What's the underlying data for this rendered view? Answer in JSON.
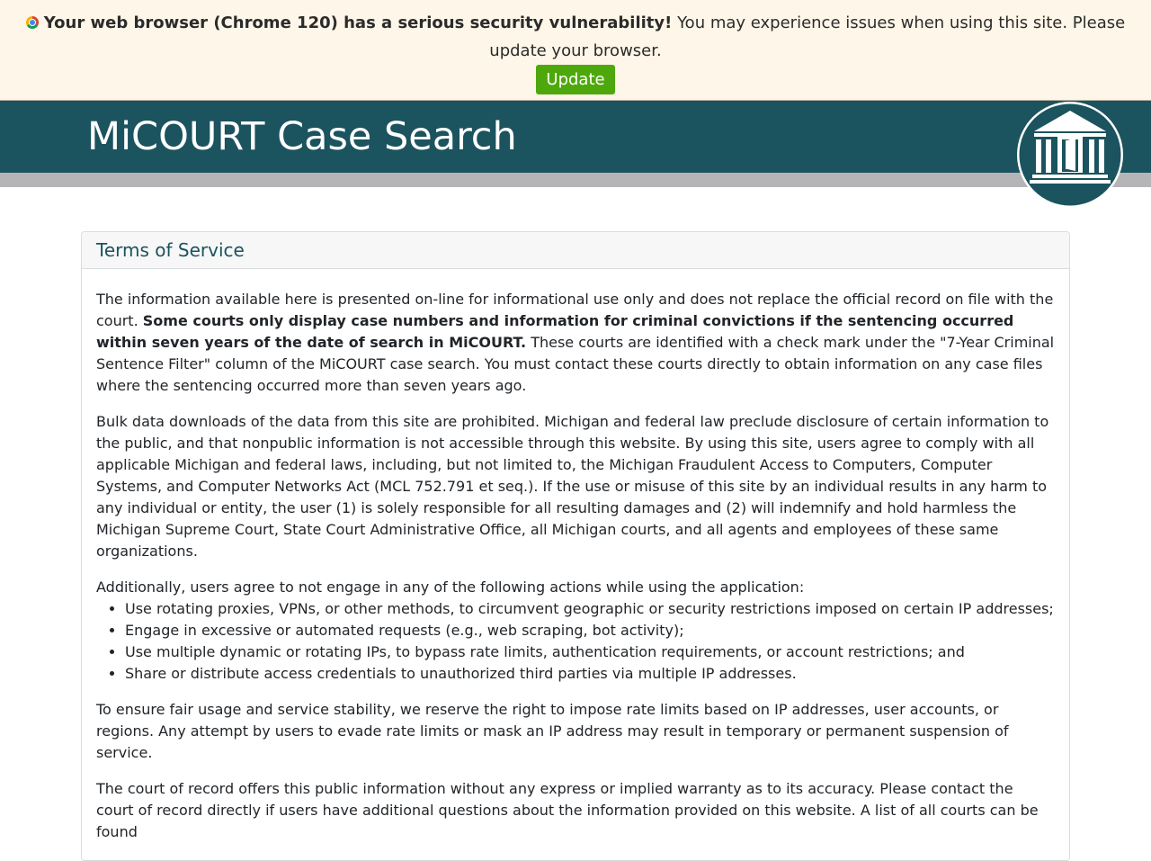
{
  "banner": {
    "warning_bold": "Your web browser (Chrome 120) has a serious security vulnerability!",
    "warning_rest": " You may experience issues when using this site. Please update your browser.",
    "update_label": "Update",
    "colors": {
      "background": "#fef6e8",
      "button": "#4ea80b"
    }
  },
  "header": {
    "title": "MiCOURT Case Search",
    "logo_icon": "courthouse-seal-icon",
    "colors": {
      "bar": "#1b535e",
      "subbar": "#b5b5b8"
    }
  },
  "terms": {
    "heading": "Terms of Service",
    "p1_start": "The information available here is presented on-line for informational use only and does not replace the official record on file with the court. ",
    "p1_bold": "Some courts only display case numbers and information for criminal convictions if the sentencing occurred within seven years of the date of search in MiCOURT.",
    "p1_end": " These courts are identified with a check mark under the \"7-Year Criminal Sentence Filter\" column of the MiCOURT case search. You must contact these courts directly to obtain information on any case files where the sentencing occurred more than seven years ago.",
    "p2": "Bulk data downloads of the data from this site are prohibited. Michigan and federal law preclude disclosure of certain information to the public, and that nonpublic information is not accessible through this website. By using this site, users agree to comply with all applicable Michigan and federal laws, including, but not limited to, the Michigan Fraudulent Access to Computers, Computer Systems, and Computer Networks Act (MCL 752.791 et seq.). If the use or misuse of this site by an individual results in any harm to any individual or entity, the user (1) is solely responsible for all resulting damages and (2) will indemnify and hold harmless the Michigan Supreme Court, State Court Administrative Office, all Michigan courts, and all agents and employees of these same organizations.",
    "p3_intro": "Additionally, users agree to not engage in any of the following actions while using the application:",
    "list": [
      "Use rotating proxies, VPNs, or other methods, to circumvent geographic or security restrictions imposed on certain IP addresses;",
      "Engage in excessive or automated requests (e.g., web scraping, bot activity);",
      "Use multiple dynamic or rotating IPs, to bypass rate limits, authentication requirements, or account restrictions; and",
      "Share or distribute access credentials to unauthorized third parties via multiple IP addresses."
    ],
    "p4": "To ensure fair usage and service stability, we reserve the right to impose rate limits based on IP addresses, user accounts, or regions. Any attempt by users to evade rate limits or mask an IP address may result in temporary or permanent suspension of service.",
    "p5": "The court of record offers this public information without any express or implied warranty as to its accuracy. Please contact the court of record directly if users have additional questions about the information provided on this website. A list of all courts can be found"
  }
}
